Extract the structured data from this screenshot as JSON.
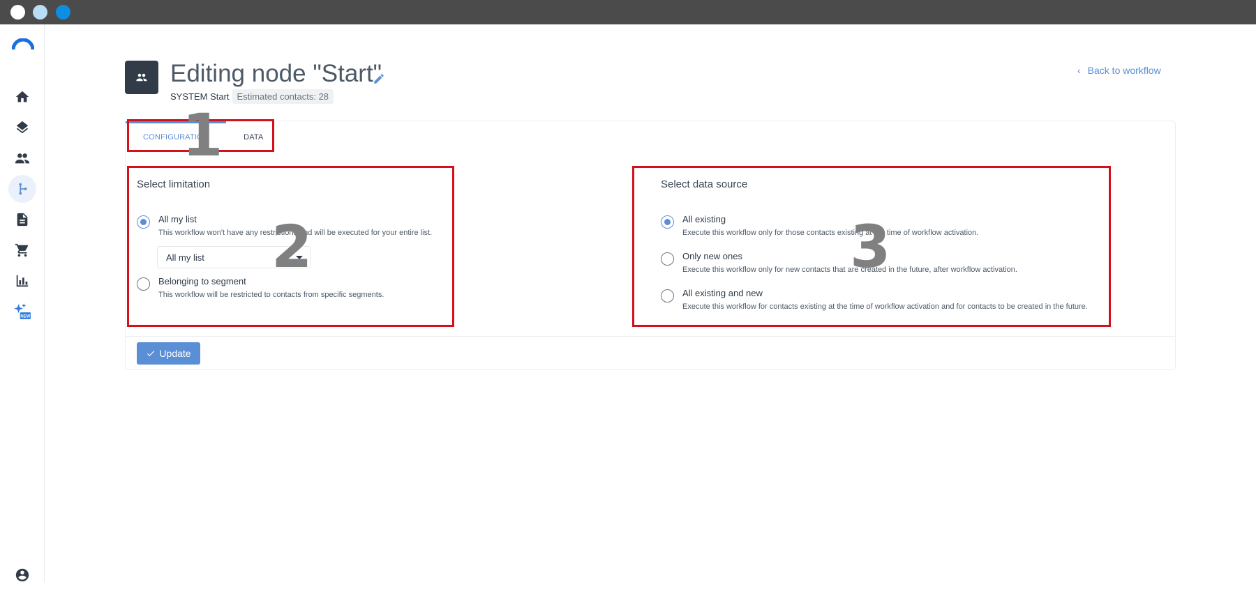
{
  "window": {
    "dots": [
      "close",
      "minimize",
      "maximize"
    ]
  },
  "sidebar": {
    "items": [
      {
        "icon": "home-icon"
      },
      {
        "icon": "layers-icon"
      },
      {
        "icon": "people-icon"
      },
      {
        "icon": "workflow-icon",
        "active": true
      },
      {
        "icon": "document-icon"
      },
      {
        "icon": "cart-icon"
      },
      {
        "icon": "bar-chart-icon"
      },
      {
        "icon": "sparkle-new-icon",
        "badge": "NEW"
      }
    ],
    "profile_icon": "account-icon"
  },
  "header": {
    "title": "Editing node \"Start\"",
    "system_label": "SYSTEM Start",
    "estimated_contacts": "Estimated contacts: 28",
    "back_link": "Back to workflow"
  },
  "tabs": [
    {
      "label": "CONFIGURATION",
      "active": true
    },
    {
      "label": "DATA",
      "active": false
    }
  ],
  "limitation": {
    "title": "Select limitation",
    "options": [
      {
        "label": "All my list",
        "description": "This workflow won't have any restrictions and will be executed for your entire list.",
        "checked": true
      },
      {
        "label": "Belonging to segment",
        "description": "This workflow will be restricted to contacts from specific segments.",
        "checked": false
      }
    ],
    "select_value": "All my list"
  },
  "data_source": {
    "title": "Select data source",
    "options": [
      {
        "label": "All existing",
        "description": "Execute this workflow only for those contacts existing at the time of workflow activation.",
        "checked": true
      },
      {
        "label": "Only new ones",
        "description": "Execute this workflow only for new contacts that are created in the future, after workflow activation.",
        "checked": false
      },
      {
        "label": "All existing and new",
        "description": "Execute this workflow for contacts existing at the time of workflow activation and for contacts to be created in the future.",
        "checked": false
      }
    ]
  },
  "actions": {
    "update_label": "Update"
  },
  "annotations": {
    "box1": "1",
    "box2": "2",
    "box3": "3"
  },
  "colors": {
    "accent": "#5a8fd6",
    "annotation": "#d4101a",
    "header_icon_bg": "#323c48"
  }
}
